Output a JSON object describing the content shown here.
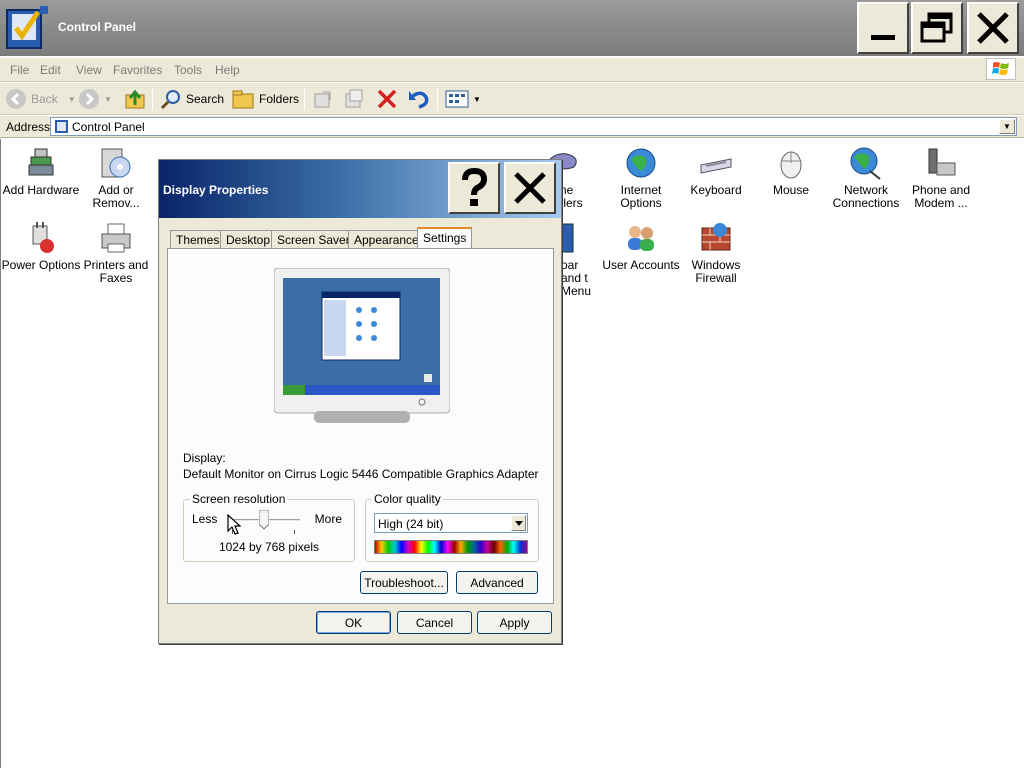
{
  "window": {
    "title": "Control Panel",
    "minimize": "minimize",
    "restore": "restore",
    "close": "close"
  },
  "menu": [
    "File",
    "Edit",
    "View",
    "Favorites",
    "Tools",
    "Help"
  ],
  "toolbar": {
    "back": "Back",
    "search": "Search",
    "folders": "Folders"
  },
  "address": {
    "label": "Address",
    "value": "Control Panel"
  },
  "items": [
    {
      "label": "Add Hardware"
    },
    {
      "label": "Add or Remov..."
    },
    {
      "label": "ame rollers"
    },
    {
      "label": "Internet Options"
    },
    {
      "label": "Keyboard"
    },
    {
      "label": "Mouse"
    },
    {
      "label": "Network Connections"
    },
    {
      "label": "Phone and Modem ..."
    },
    {
      "label": "Power Options"
    },
    {
      "label": "Printers and Faxes"
    },
    {
      "label": "oar and t Menu"
    },
    {
      "label": "User Accounts"
    },
    {
      "label": "Windows Firewall"
    }
  ],
  "dialog": {
    "title": "Display Properties",
    "tabs": [
      "Themes",
      "Desktop",
      "Screen Saver",
      "Appearance",
      "Settings"
    ],
    "active_tab": "Settings",
    "display_label": "Display:",
    "display_value": "Default Monitor on Cirrus Logic 5446 Compatible Graphics Adapter",
    "resolution": {
      "title": "Screen resolution",
      "less": "Less",
      "more": "More",
      "value": "1024 by 768 pixels",
      "slider_fraction": 0.5
    },
    "color": {
      "title": "Color quality",
      "value": "High (24 bit)"
    },
    "buttons": {
      "troubleshoot": "Troubleshoot...",
      "advanced": "Advanced",
      "ok": "OK",
      "cancel": "Cancel",
      "apply": "Apply"
    }
  }
}
